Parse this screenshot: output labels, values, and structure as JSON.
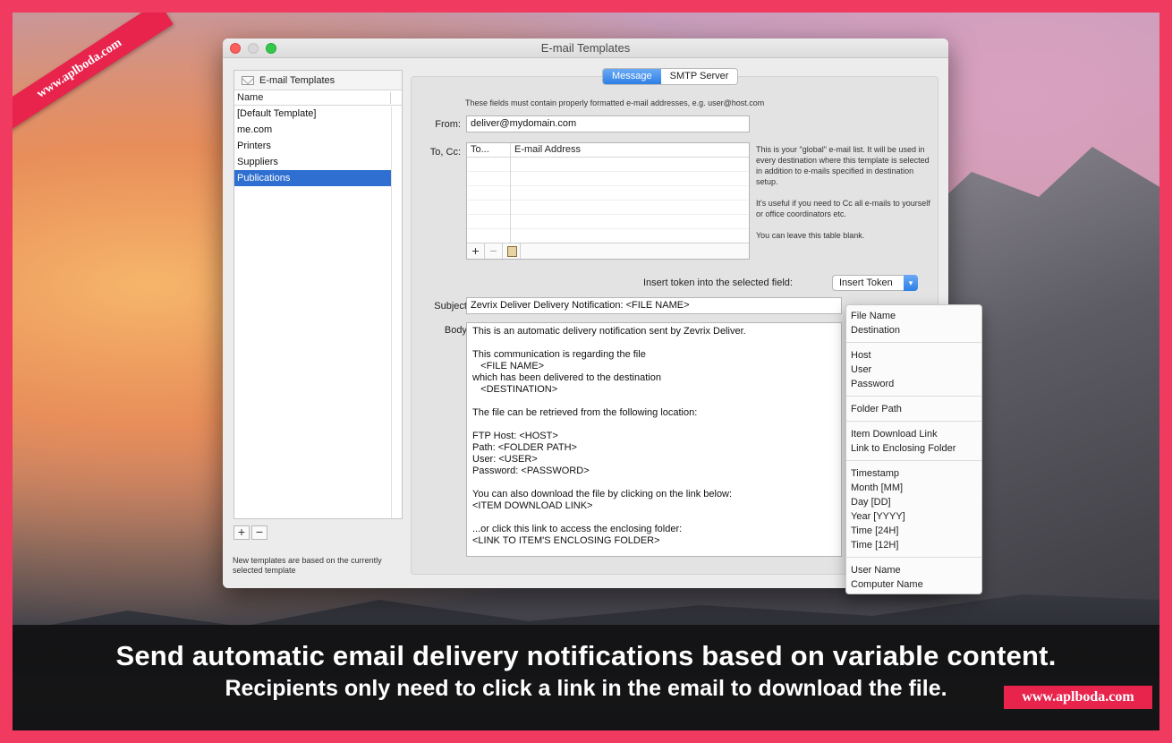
{
  "watermark": {
    "ribbon": "www.aplboda.com",
    "corner": "www.aplboda.com"
  },
  "caption": {
    "line1": "Send automatic email delivery notifications based on variable content.",
    "line2": "Recipients only need to click a link in the email to download the file."
  },
  "window": {
    "title": "E-mail Templates"
  },
  "sidebar": {
    "header": "E-mail Templates",
    "column": "Name",
    "items": [
      "[Default Template]",
      "me.com",
      "Printers",
      "Suppliers",
      "Publications"
    ],
    "selected": "Publications",
    "add_label": "+",
    "remove_label": "−",
    "note": "New templates are based on the currently selected template"
  },
  "tabs": {
    "message": "Message",
    "smtp": "SMTP Server",
    "active": "Message"
  },
  "form": {
    "hint": "These fields must contain properly formatted e-mail addresses, e.g. user@host.com",
    "from_label": "From:",
    "from_value": "deliver@mydomain.com",
    "tocc_label": "To, Cc:",
    "table_cols": [
      "To...",
      "E-mail Address"
    ],
    "table_add": "+",
    "table_remove": "−",
    "info": [
      "This is your \"global\" e-mail list. It will be used in every destination where this template is selected in addition to e-mails specified in destination setup.",
      "It's useful if you need to Cc all e-mails to yourself or office coordinators etc.",
      "You can leave this table blank."
    ],
    "token_label": "Insert token into the selected field:",
    "token_button": "Insert Token",
    "subject_label": "Subject:",
    "subject_value": "Zevrix Deliver Delivery Notification: <FILE NAME>",
    "body_label": "Body:",
    "body_value": "This is an automatic delivery notification sent by Zevrix Deliver.\n\nThis communication is regarding the file\n   <FILE NAME>\nwhich has been delivered to the destination\n   <DESTINATION>\n\nThe file can be retrieved from the following location:\n\nFTP Host: <HOST>\nPath: <FOLDER PATH>\nUser: <USER>\nPassword: <PASSWORD>\n\nYou can also download the file by clicking on the link below:\n<ITEM DOWNLOAD LINK>\n\n...or click this link to access the enclosing folder:\n<LINK TO ITEM'S ENCLOSING FOLDER>"
  },
  "token_menu": [
    [
      "File Name",
      "Destination"
    ],
    [
      "Host",
      "User",
      "Password"
    ],
    [
      "Folder Path"
    ],
    [
      "Item Download Link",
      "Link to Enclosing Folder"
    ],
    [
      "Timestamp",
      "Month [MM]",
      "Day [DD]",
      "Year [YYYY]",
      "Time [24H]",
      "Time [12H]"
    ],
    [
      "User Name",
      "Computer Name"
    ]
  ],
  "colors": {
    "accent": "#2f6fd1",
    "frame": "#f03a60",
    "ribbon": "#e8234c"
  }
}
